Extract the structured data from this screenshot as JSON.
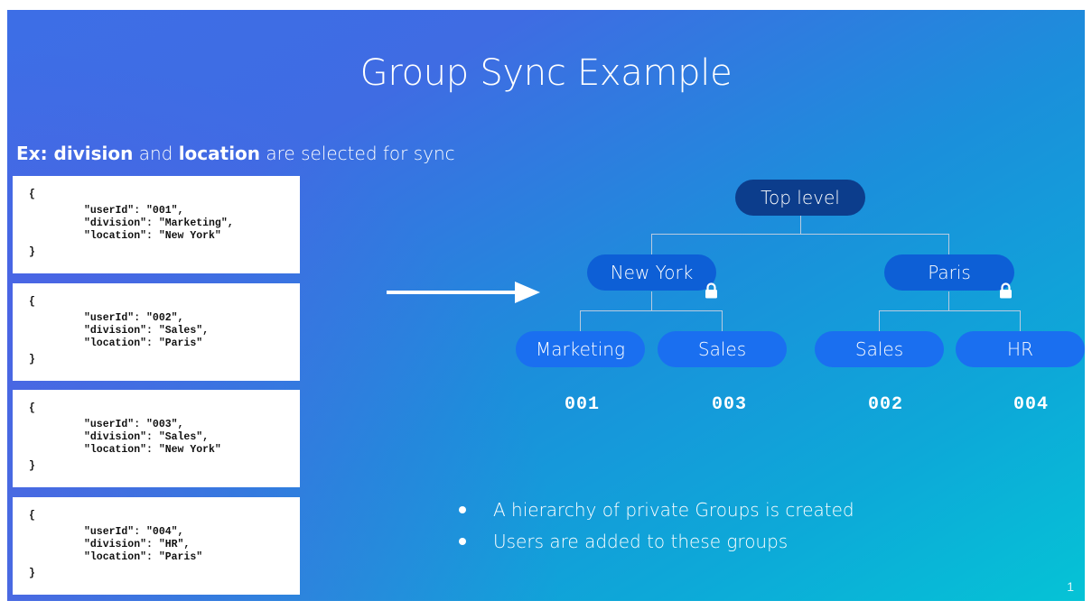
{
  "slide": {
    "title": "Group Sync Example",
    "subtitle_prefix": "Ex: ",
    "subtitle_bold_1": "division",
    "subtitle_mid": " and ",
    "subtitle_bold_2": "location",
    "subtitle_suffix": " are selected for sync",
    "page_number": "1"
  },
  "records": [
    {
      "open": "{",
      "line1": "\"userId\": \"001\",",
      "line2": "\"division\": \"Marketing\",",
      "line3": "\"location\": \"New York\"",
      "close": "}"
    },
    {
      "open": "{",
      "line1": "\"userId\": \"002\",",
      "line2": "\"division\": \"Sales\",",
      "line3": "\"location\": \"Paris\"",
      "close": "}"
    },
    {
      "open": "{",
      "line1": "\"userId\": \"003\",",
      "line2": "\"division\": \"Sales\",",
      "line3": "\"location\": \"New York\"",
      "close": "}"
    },
    {
      "open": "{",
      "line1": "\"userId\": \"004\",",
      "line2": "\"division\": \"HR\",",
      "line3": "\"location\": \"Paris\"",
      "close": "}"
    }
  ],
  "tree": {
    "top": "Top level",
    "location_1": "New York",
    "location_2": "Paris",
    "group_1": "Marketing",
    "group_2": "Sales",
    "group_3": "Sales",
    "group_4": "HR",
    "user_1": "001",
    "user_2": "003",
    "user_3": "002",
    "user_4": "004"
  },
  "bullets": [
    "A hierarchy of private Groups is created",
    "Users are added to these groups"
  ],
  "icons": {
    "lock": "lock-icon",
    "arrow": "arrow-right-icon"
  }
}
